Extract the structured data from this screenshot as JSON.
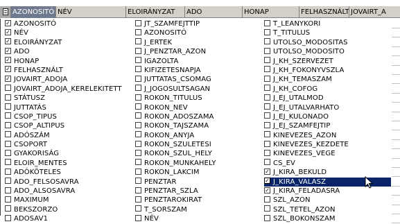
{
  "header": {
    "columns": [
      "AZONOSITÓ",
      "NÉV",
      "ELOIRÁNYZAT",
      "ADO",
      "HONAP",
      "FELHASZNÁLT",
      "JOVAIRT_A"
    ]
  },
  "columns": [
    {
      "items": [
        {
          "label": "AZONOSITÓ",
          "checked": true
        },
        {
          "label": "NÉV",
          "checked": true
        },
        {
          "label": "ELOIRÁNYZAT",
          "checked": true
        },
        {
          "label": "ADO",
          "checked": true
        },
        {
          "label": "HONAP",
          "checked": true
        },
        {
          "label": "FELHASZNÁLT",
          "checked": true
        },
        {
          "label": "JOVAIRT_ADOJA",
          "checked": true
        },
        {
          "label": "JOVAIRT_ADOJA_KERELEKITETT",
          "checked": false
        },
        {
          "label": "STÁTUSZ",
          "checked": false
        },
        {
          "label": "JUTTATÁS",
          "checked": false
        },
        {
          "label": "CSOP_TIPUS",
          "checked": false
        },
        {
          "label": "CSOP_ALTIPUS",
          "checked": false
        },
        {
          "label": "ADÓSZÁM",
          "checked": false
        },
        {
          "label": "CSOPORT",
          "checked": false
        },
        {
          "label": "GYAKORISÁG",
          "checked": false
        },
        {
          "label": "ELOIR_MENTES",
          "checked": false
        },
        {
          "label": "ADÓKÖTELES",
          "checked": false
        },
        {
          "label": "ADO_FELSOSAVRA",
          "checked": false
        },
        {
          "label": "ADO_ALSOSAVRA",
          "checked": false
        },
        {
          "label": "MAXIMUM",
          "checked": false
        },
        {
          "label": "BEKSZORZO",
          "checked": false
        },
        {
          "label": "ADOSAV1",
          "checked": false
        }
      ]
    },
    {
      "items": [
        {
          "label": "JT_SZAMFEJTTIP",
          "checked": false
        },
        {
          "label": "AZONOSITÓ",
          "checked": false
        },
        {
          "label": "J_ERTEK",
          "checked": false
        },
        {
          "label": "J_PENZTAR_AZON",
          "checked": false
        },
        {
          "label": "IGAZOLTA",
          "checked": false
        },
        {
          "label": "KIFIZETESNAPJA",
          "checked": false
        },
        {
          "label": "JUTTATAS_CSOMAG",
          "checked": false
        },
        {
          "label": "J_JOGOSULTSAGAN",
          "checked": false
        },
        {
          "label": "ROKON_TITULUS",
          "checked": false
        },
        {
          "label": "ROKON_NEV",
          "checked": false
        },
        {
          "label": "ROKON_ADOSZAMA",
          "checked": false
        },
        {
          "label": "ROKON_TAJSZAMA",
          "checked": false
        },
        {
          "label": "ROKON_ANYJA",
          "checked": false
        },
        {
          "label": "ROKON_SZULETESI",
          "checked": false
        },
        {
          "label": "ROKON_SZUL_HELY",
          "checked": false
        },
        {
          "label": "ROKON_MUNKAHELY",
          "checked": false
        },
        {
          "label": "ROKON_LAKCIM",
          "checked": false
        },
        {
          "label": "PENZTAR",
          "checked": false
        },
        {
          "label": "PENZTAR_SZLA",
          "checked": false
        },
        {
          "label": "PENZTAROKIRAT",
          "checked": false
        },
        {
          "label": "T_SORSZAM",
          "checked": false
        },
        {
          "label": "NÉV",
          "checked": false
        }
      ]
    },
    {
      "items": [
        {
          "label": "T_LEANYKORI",
          "checked": false
        },
        {
          "label": "T_TITULUS",
          "checked": false
        },
        {
          "label": "UTOLSO_MODOSITAS",
          "checked": false
        },
        {
          "label": "UTOLSO_MODOSITO",
          "checked": false
        },
        {
          "label": "J_KH_SZERVEZET",
          "checked": false
        },
        {
          "label": "J_KH_FOKONYVSZLA",
          "checked": false
        },
        {
          "label": "J_KH_TEMASZAM",
          "checked": false
        },
        {
          "label": "J_KH_COFOG",
          "checked": false
        },
        {
          "label": "J_EJ_UTALMOD",
          "checked": false
        },
        {
          "label": "J_EJ_UTALVARHATO",
          "checked": false
        },
        {
          "label": "J_EJ_KULONADO",
          "checked": false
        },
        {
          "label": "J_EJ_SZAMFEJTIP",
          "checked": false
        },
        {
          "label": "KINEVEZES_AZON",
          "checked": false
        },
        {
          "label": "KINEVEZES_KEZDETE",
          "checked": false
        },
        {
          "label": "KINEVEZES_VEGE",
          "checked": false
        },
        {
          "label": "CS_EV",
          "checked": false
        },
        {
          "label": "J_KIRA_BEKULD",
          "checked": true
        },
        {
          "label": "J_KIRA_VALASZ",
          "checked": true,
          "highlighted": true
        },
        {
          "label": "J_KIRA_FELADASRA",
          "checked": true
        },
        {
          "label": "SZL_AZON",
          "checked": false
        },
        {
          "label": "SZL_TETEL_AZON",
          "checked": false
        },
        {
          "label": "SZL_BOKONSZAM",
          "checked": false
        }
      ]
    }
  ]
}
